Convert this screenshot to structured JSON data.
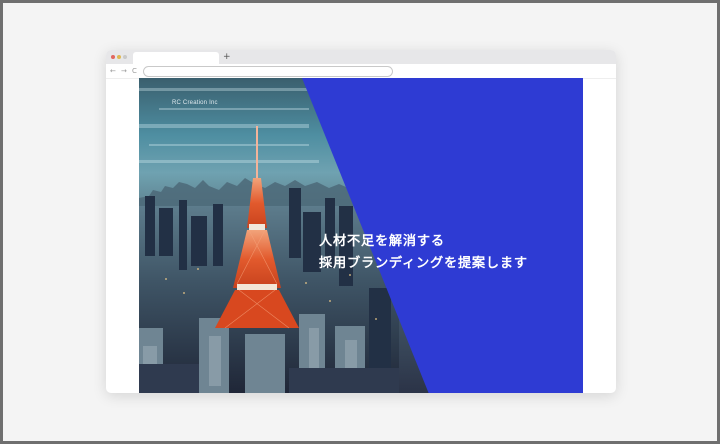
{
  "browser": {
    "new_tab_symbol": "+",
    "nav": {
      "back": "←",
      "forward": "→",
      "reload": "C"
    },
    "url": ""
  },
  "hero": {
    "company": "RC Creation Inc",
    "headline": [
      "人材不足を解消する",
      "採用ブランディングを提案します"
    ],
    "accent_color": "#2e3bd3",
    "photo": "Tokyo Tower at dusk over a city skyline"
  }
}
